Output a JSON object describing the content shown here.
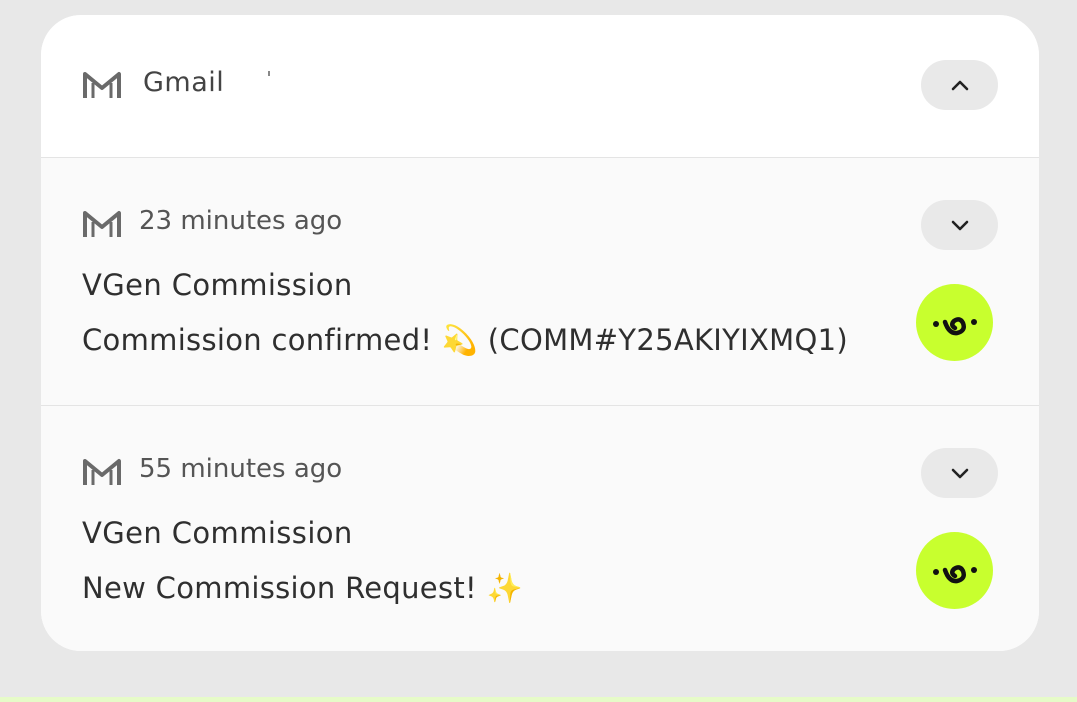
{
  "group": {
    "app_name": "Gmail",
    "collapse_icon": "chevron-up-icon"
  },
  "notifications": [
    {
      "time": "23 minutes ago",
      "sender": "VGen Commission",
      "message": "Commission confirmed! 💫 (COMM#Y25AKIYIXMQ1)",
      "expand_icon": "chevron-down-icon",
      "avatar_icon": "vgen-face-icon"
    },
    {
      "time": "55 minutes ago",
      "sender": "VGen Commission",
      "message": "New Commission Request! ✨",
      "expand_icon": "chevron-down-icon",
      "avatar_icon": "vgen-face-icon"
    }
  ],
  "colors": {
    "avatar": "#c8ff2e",
    "card": "#fafafa",
    "background": "#e8e8e8"
  }
}
